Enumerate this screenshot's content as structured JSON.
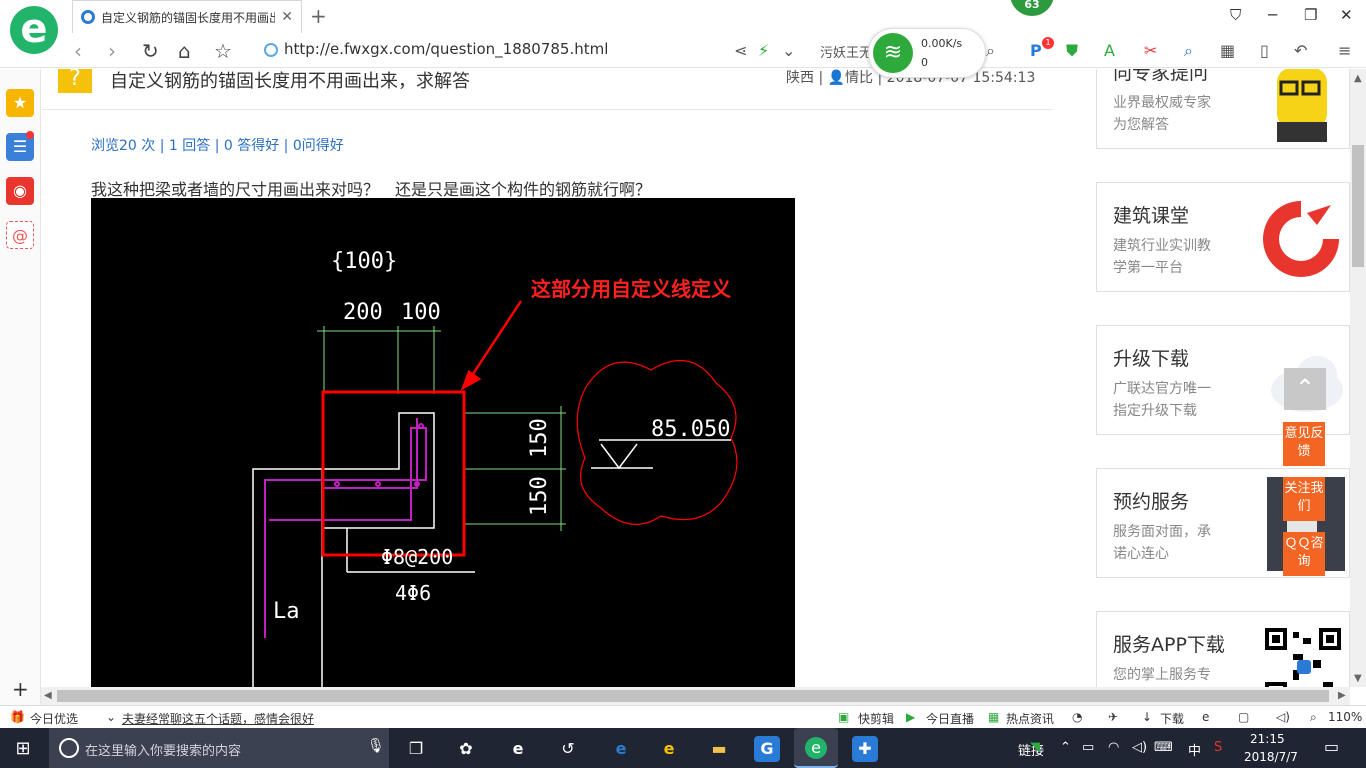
{
  "browser": {
    "tab_title": "自定义钢筋的锚固长度用不用画出",
    "badge_count": "63",
    "url": "http://e.fwxgx.com/question_1880785.html",
    "toolbar_text": "污妖王无",
    "net_speed": "0.00K/s",
    "net_count": "0",
    "ext_badge": "1"
  },
  "question": {
    "title": "自定义钢筋的锚固长度用不用画出来，求解答",
    "meta": "陕西 | 👤情比 | 2018-07-07 15:54:13",
    "stats": "浏览20 次 | 1 回答 | 0 答得好 | 0问得好",
    "body": "我这种把梁或者墙的尺寸用画出来对吗？　还是只是画这个构件的钢筋就行啊？"
  },
  "drawing": {
    "dim_top": "{100}",
    "dim_200": "200",
    "dim_100": "100",
    "annotation": "这部分用自定义线定义",
    "elevation": "85.050",
    "dim_150a": "150",
    "dim_150b": "150",
    "stirrup": "Φ8@200",
    "bars": "4Φ6",
    "la": "La"
  },
  "cards": [
    {
      "title": "向专家提问",
      "sub1": "业界最权威专家",
      "sub2": "为您解答"
    },
    {
      "title": "建筑课堂",
      "sub1": "建筑行业实训教",
      "sub2": "学第一平台"
    },
    {
      "title": "升级下载",
      "sub1": "广联达官方唯一",
      "sub2": "指定升级下载"
    },
    {
      "title": "预约服务",
      "sub1": "服务面对面，承",
      "sub2": "诺心连心"
    },
    {
      "title": "服务APP下载",
      "sub1": "您的掌上服务专",
      "sub2": ""
    }
  ],
  "float_buttons": {
    "feedback": "意见反馈",
    "follow": "关注我们",
    "qq": "ＱＱ咨询"
  },
  "statusbar": {
    "today": "今日优选",
    "news": "夫妻经常聊这五个话题，感情会很好",
    "kuaijian": "快剪辑",
    "live": "今日直播",
    "hot": "热点资讯",
    "download": "下载",
    "zoom": "110%"
  },
  "taskbar": {
    "search_placeholder": "在这里输入你要搜索的内容",
    "link_label": "链接",
    "ime": "中",
    "time": "21:15",
    "date": "2018/7/7"
  },
  "colors": {
    "brand_green": "#23b46b",
    "accent_orange": "#f26522",
    "link_blue": "#2a6fc2",
    "cad_red": "#ff0000",
    "cad_magenta": "#c020c0",
    "cad_green": "#80e080"
  }
}
